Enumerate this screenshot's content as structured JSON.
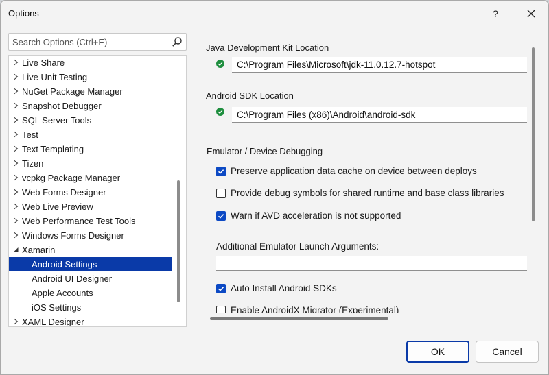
{
  "window": {
    "title": "Options",
    "help_label": "?"
  },
  "search": {
    "placeholder": "Search Options (Ctrl+E)",
    "icon": "search-icon"
  },
  "tree": {
    "items": [
      {
        "label": "Live Share",
        "expanded": false
      },
      {
        "label": "Live Unit Testing",
        "expanded": false
      },
      {
        "label": "NuGet Package Manager",
        "expanded": false
      },
      {
        "label": "Snapshot Debugger",
        "expanded": false
      },
      {
        "label": "SQL Server Tools",
        "expanded": false
      },
      {
        "label": "Test",
        "expanded": false
      },
      {
        "label": "Text Templating",
        "expanded": false
      },
      {
        "label": "Tizen",
        "expanded": false
      },
      {
        "label": "vcpkg Package Manager",
        "expanded": false
      },
      {
        "label": "Web Forms Designer",
        "expanded": false
      },
      {
        "label": "Web Live Preview",
        "expanded": false
      },
      {
        "label": "Web Performance Test Tools",
        "expanded": false
      },
      {
        "label": "Windows Forms Designer",
        "expanded": false
      },
      {
        "label": "Xamarin",
        "expanded": true
      },
      {
        "label": "Android Settings",
        "child": true,
        "selected": true
      },
      {
        "label": "Android UI Designer",
        "child": true
      },
      {
        "label": "Apple Accounts",
        "child": true
      },
      {
        "label": "iOS Settings",
        "child": true
      },
      {
        "label": "XAML Designer",
        "expanded": false
      }
    ]
  },
  "settings": {
    "jdk_label": "Java Development Kit Location",
    "jdk_path": "C:\\Program Files\\Microsoft\\jdk-11.0.12.7-hotspot",
    "sdk_label": "Android SDK Location",
    "sdk_path": "C:\\Program Files (x86)\\Android\\android-sdk",
    "emulator_section": "Emulator / Device Debugging",
    "checkboxes": [
      {
        "label": "Preserve application data cache on device between deploys",
        "checked": true
      },
      {
        "label": "Provide debug symbols for shared runtime and base class libraries",
        "checked": false
      },
      {
        "label": "Warn if AVD acceleration is not supported",
        "checked": true
      },
      {
        "label": "Auto Install Android SDKs",
        "checked": true
      },
      {
        "label": "Enable AndroidX Migrator (Experimental)",
        "checked": false
      }
    ],
    "emulator_args_label": "Additional Emulator Launch Arguments:",
    "emulator_args_value": ""
  },
  "buttons": {
    "ok": "OK",
    "cancel": "Cancel"
  },
  "colors": {
    "accent": "#0a3aa8",
    "checkbox": "#0c49c4",
    "success": "#1e8e3e"
  }
}
